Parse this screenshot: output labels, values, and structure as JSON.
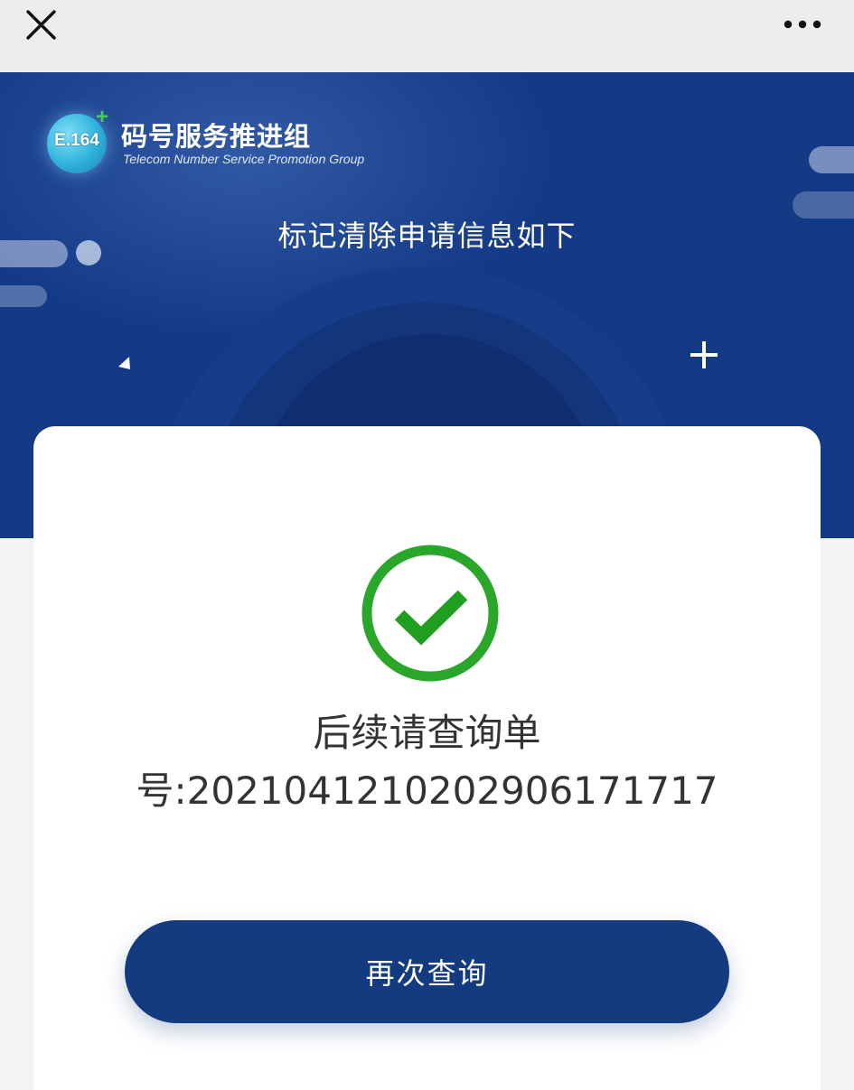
{
  "topbar": {
    "close_icon": "close-icon",
    "more_icon": "more-horizontal-icon"
  },
  "header": {
    "logo": {
      "badge_text": "E.164",
      "plus_symbol": "+",
      "org_name_cn": "码号服务推进组",
      "org_name_en": "Telecom Number Service  Promotion Group"
    },
    "title": "标记清除申请信息如下"
  },
  "result": {
    "status_icon": "success-check-icon",
    "message_line1": "后续请查询单",
    "message_line2": "号:2021041210202906171717"
  },
  "actions": {
    "requery_label": "再次查询"
  },
  "colors": {
    "header_bg": "#143a86",
    "button_bg": "#143a80",
    "success_green": "#26a926",
    "text_dark": "#333333"
  }
}
